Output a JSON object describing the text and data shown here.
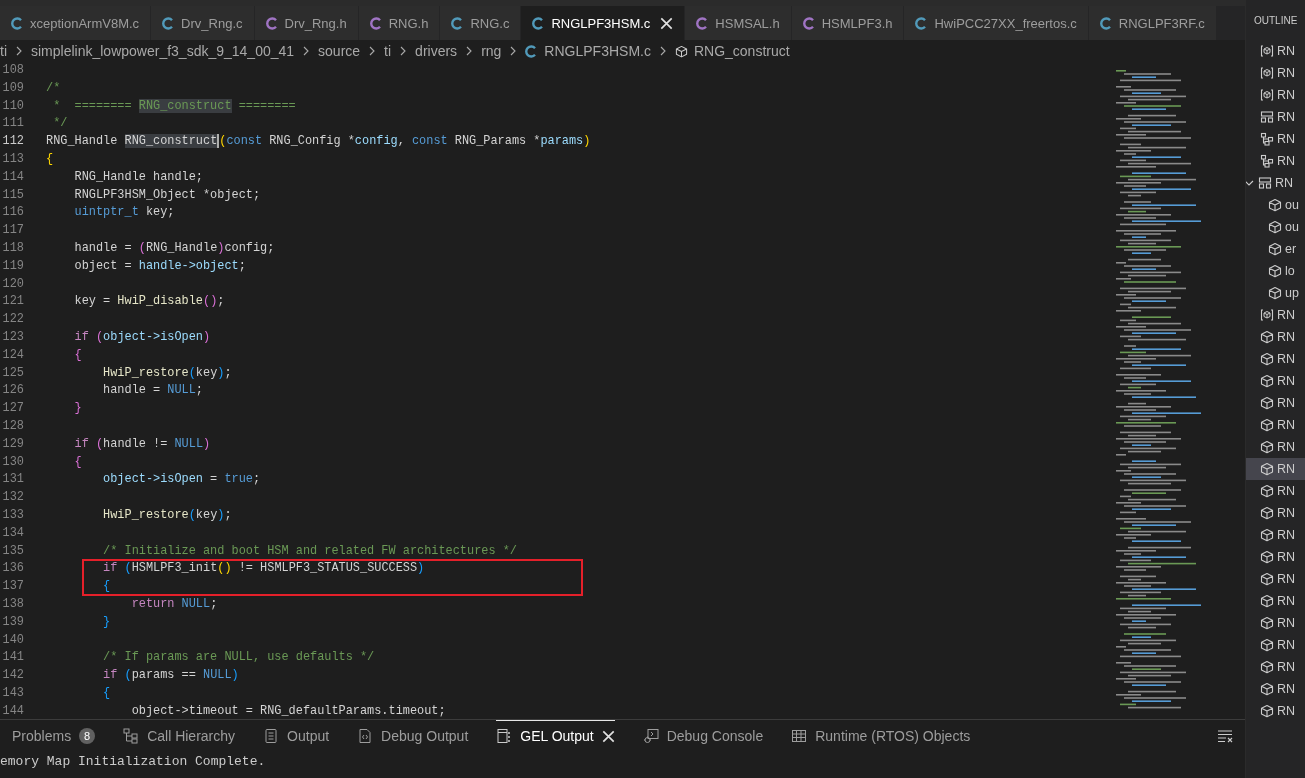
{
  "editor_tabs": [
    {
      "label": "xceptionArmV8M.c",
      "kind": "source",
      "selected": false
    },
    {
      "label": "Drv_Rng.c",
      "kind": "source",
      "selected": false
    },
    {
      "label": "Drv_Rng.h",
      "kind": "header",
      "selected": false
    },
    {
      "label": "RNG.h",
      "kind": "header",
      "selected": false
    },
    {
      "label": "RNG.c",
      "kind": "source",
      "selected": false
    },
    {
      "label": "RNGLPF3HSM.c",
      "kind": "source",
      "selected": true
    },
    {
      "label": "HSMSAL.h",
      "kind": "header",
      "selected": false
    },
    {
      "label": "HSMLPF3.h",
      "kind": "header",
      "selected": false
    },
    {
      "label": "HwiPCC27XX_freertos.c",
      "kind": "source",
      "selected": false
    },
    {
      "label": "RNGLPF3RF.c",
      "kind": "source",
      "selected": false
    }
  ],
  "breadcrumb": [
    {
      "label": "ti",
      "kind": "folder"
    },
    {
      "label": "simplelink_lowpower_f3_sdk_9_14_00_41",
      "kind": "folder"
    },
    {
      "label": "source",
      "kind": "folder"
    },
    {
      "label": "ti",
      "kind": "folder"
    },
    {
      "label": "drivers",
      "kind": "folder"
    },
    {
      "label": "rng",
      "kind": "folder"
    },
    {
      "label": "RNGLPF3HSM.c",
      "kind": "file"
    },
    {
      "label": "RNG_construct",
      "kind": "symbol"
    }
  ],
  "editor": {
    "lines": [
      {
        "number": "108",
        "current": false
      },
      {
        "number": "109",
        "current": false,
        "tokens": [
          {
            "text": "/*",
            "kind": "comment"
          }
        ]
      },
      {
        "number": "110",
        "current": false,
        "tokens": [
          {
            "text": " *  ======== ",
            "kind": "comment"
          },
          {
            "text": "RNG_construct",
            "kind": "comment-match"
          },
          {
            "text": " ========",
            "kind": "comment"
          }
        ]
      },
      {
        "number": "111",
        "current": false,
        "tokens": [
          {
            "text": " */",
            "kind": "comment"
          }
        ]
      },
      {
        "number": "112",
        "current": true,
        "tokens": [
          {
            "text": "RNG_Handle ",
            "kind": "plain"
          },
          {
            "text": "RNG_construct",
            "kind": "match"
          },
          {
            "text": "(",
            "kind": "bracket1"
          },
          {
            "text": "const",
            "kind": "keyword"
          },
          {
            "text": " RNG_Config *",
            "kind": "plain"
          },
          {
            "text": "config",
            "kind": "variable"
          },
          {
            "text": ", ",
            "kind": "plain"
          },
          {
            "text": "const",
            "kind": "keyword"
          },
          {
            "text": " RNG_Params *",
            "kind": "plain"
          },
          {
            "text": "params",
            "kind": "variable"
          },
          {
            "text": ")",
            "kind": "bracket1"
          }
        ]
      },
      {
        "number": "113",
        "current": false,
        "tokens": [
          {
            "text": "{",
            "kind": "bracket1"
          }
        ]
      },
      {
        "number": "114",
        "current": false,
        "tokens": [
          {
            "text": "    RNG_Handle handle;",
            "kind": "plain"
          }
        ]
      },
      {
        "number": "115",
        "current": false,
        "tokens": [
          {
            "text": "    RNGLPF3HSM_Object *object;",
            "kind": "plain"
          }
        ]
      },
      {
        "number": "116",
        "current": false,
        "tokens": [
          {
            "text": "    uintptr_t",
            "kind": "keyword"
          },
          {
            "text": " key;",
            "kind": "plain"
          }
        ]
      },
      {
        "number": "117",
        "current": false
      },
      {
        "number": "118",
        "current": false,
        "tokens": [
          {
            "text": "    handle = ",
            "kind": "plain"
          },
          {
            "text": "(",
            "kind": "bracket2"
          },
          {
            "text": "RNG_Handle",
            "kind": "plain"
          },
          {
            "text": ")",
            "kind": "bracket2"
          },
          {
            "text": "config;",
            "kind": "plain"
          }
        ]
      },
      {
        "number": "119",
        "current": false,
        "tokens": [
          {
            "text": "    object = ",
            "kind": "plain"
          },
          {
            "text": "handle->object",
            "kind": "variable"
          },
          {
            "text": ";",
            "kind": "plain"
          }
        ]
      },
      {
        "number": "120",
        "current": false
      },
      {
        "number": "121",
        "current": false,
        "tokens": [
          {
            "text": "    key = ",
            "kind": "plain"
          },
          {
            "text": "HwiP_disable",
            "kind": "function"
          },
          {
            "text": "()",
            "kind": "bracket2"
          },
          {
            "text": ";",
            "kind": "plain"
          }
        ]
      },
      {
        "number": "122",
        "current": false
      },
      {
        "number": "123",
        "current": false,
        "tokens": [
          {
            "text": "    if",
            "kind": "control"
          },
          {
            "text": " (",
            "kind": "bracket2"
          },
          {
            "text": "object->isOpen",
            "kind": "variable"
          },
          {
            "text": ")",
            "kind": "bracket2"
          }
        ]
      },
      {
        "number": "124",
        "current": false,
        "tokens": [
          {
            "text": "    {",
            "kind": "bracket2"
          }
        ]
      },
      {
        "number": "125",
        "current": false,
        "tokens": [
          {
            "text": "        HwiP_restore",
            "kind": "function"
          },
          {
            "text": "(",
            "kind": "bracket3"
          },
          {
            "text": "key",
            "kind": "plain"
          },
          {
            "text": ")",
            "kind": "bracket3"
          },
          {
            "text": ";",
            "kind": "plain"
          }
        ]
      },
      {
        "number": "126",
        "current": false,
        "tokens": [
          {
            "text": "        handle = ",
            "kind": "plain"
          },
          {
            "text": "NULL",
            "kind": "keyword"
          },
          {
            "text": ";",
            "kind": "plain"
          }
        ]
      },
      {
        "number": "127",
        "current": false,
        "tokens": [
          {
            "text": "    }",
            "kind": "bracket2"
          }
        ]
      },
      {
        "number": "128",
        "current": false
      },
      {
        "number": "129",
        "current": false,
        "tokens": [
          {
            "text": "    if",
            "kind": "control"
          },
          {
            "text": " (",
            "kind": "bracket2"
          },
          {
            "text": "handle != ",
            "kind": "plain"
          },
          {
            "text": "NULL",
            "kind": "keyword"
          },
          {
            "text": ")",
            "kind": "bracket2"
          }
        ]
      },
      {
        "number": "130",
        "current": false,
        "tokens": [
          {
            "text": "    {",
            "kind": "bracket2"
          }
        ]
      },
      {
        "number": "131",
        "current": false,
        "tokens": [
          {
            "text": "        object->isOpen",
            "kind": "variable"
          },
          {
            "text": " = ",
            "kind": "plain"
          },
          {
            "text": "true",
            "kind": "keyword"
          },
          {
            "text": ";",
            "kind": "plain"
          }
        ]
      },
      {
        "number": "132",
        "current": false
      },
      {
        "number": "133",
        "current": false,
        "tokens": [
          {
            "text": "        HwiP_restore",
            "kind": "function"
          },
          {
            "text": "(",
            "kind": "bracket3"
          },
          {
            "text": "key",
            "kind": "plain"
          },
          {
            "text": ")",
            "kind": "bracket3"
          },
          {
            "text": ";",
            "kind": "plain"
          }
        ]
      },
      {
        "number": "134",
        "current": false
      },
      {
        "number": "135",
        "current": false,
        "tokens": [
          {
            "text": "        /* Initialize and boot HSM and related FW architectures */",
            "kind": "comment"
          }
        ]
      },
      {
        "number": "136",
        "current": false,
        "tokens": [
          {
            "text": "        if",
            "kind": "control"
          },
          {
            "text": " (",
            "kind": "bracket3"
          },
          {
            "text": "HSMLPF3_init",
            "kind": "plain"
          },
          {
            "text": "()",
            "kind": "bracket1"
          },
          {
            "text": " != HSMLPF3_STATUS_SUCCESS",
            "kind": "plain"
          },
          {
            "text": ")",
            "kind": "bracket3"
          }
        ]
      },
      {
        "number": "137",
        "current": false,
        "tokens": [
          {
            "text": "        {",
            "kind": "bracket3"
          }
        ]
      },
      {
        "number": "138",
        "current": false,
        "tokens": [
          {
            "text": "            return",
            "kind": "control"
          },
          {
            "text": " NULL",
            "kind": "keyword"
          },
          {
            "text": ";",
            "kind": "plain"
          }
        ]
      },
      {
        "number": "139",
        "current": false,
        "tokens": [
          {
            "text": "        }",
            "kind": "bracket3"
          }
        ]
      },
      {
        "number": "140",
        "current": false
      },
      {
        "number": "141",
        "current": false,
        "tokens": [
          {
            "text": "        /* If params are NULL, use defaults */",
            "kind": "comment"
          }
        ]
      },
      {
        "number": "142",
        "current": false,
        "tokens": [
          {
            "text": "        if",
            "kind": "control"
          },
          {
            "text": " (",
            "kind": "bracket3"
          },
          {
            "text": "params == ",
            "kind": "plain"
          },
          {
            "text": "NULL",
            "kind": "keyword"
          },
          {
            "text": ")",
            "kind": "bracket3"
          }
        ]
      },
      {
        "number": "143",
        "current": false,
        "tokens": [
          {
            "text": "        {",
            "kind": "bracket3"
          }
        ]
      },
      {
        "number": "144",
        "current": false,
        "tokens": [
          {
            "text": "            object->timeout = RNG_defaultParams.timeout;",
            "kind": "plain"
          }
        ]
      }
    ]
  },
  "panel": {
    "tabs": [
      {
        "label": "Problems",
        "badge": "8",
        "selected": false
      },
      {
        "label": "Call Hierarchy",
        "selected": false
      },
      {
        "label": "Output",
        "selected": false
      },
      {
        "label": "Debug Output",
        "selected": false
      },
      {
        "label": "GEL Output",
        "selected": true
      },
      {
        "label": "Debug Console",
        "selected": false
      },
      {
        "label": "Runtime (RTOS) Objects",
        "selected": false
      }
    ],
    "output": "emory Map Initialization Complete."
  },
  "outline": {
    "title": "OUTLINE",
    "items": [
      {
        "kind": "variable",
        "label": "RN",
        "selected": false
      },
      {
        "kind": "variable",
        "label": "RN",
        "selected": false
      },
      {
        "kind": "variable",
        "label": "RN",
        "selected": false
      },
      {
        "kind": "struct",
        "label": "RN",
        "selected": false
      },
      {
        "kind": "type",
        "label": "RN",
        "selected": false
      },
      {
        "kind": "type",
        "label": "RN",
        "selected": false
      },
      {
        "kind": "struct",
        "label": "RN",
        "selected": false,
        "expanded": true,
        "children": [
          {
            "kind": "field",
            "label": "ou",
            "selected": false
          },
          {
            "kind": "field",
            "label": "ou",
            "selected": false
          },
          {
            "kind": "field",
            "label": "er",
            "selected": false
          },
          {
            "kind": "field",
            "label": "lo",
            "selected": false
          },
          {
            "kind": "field",
            "label": "up",
            "selected": false
          }
        ]
      },
      {
        "kind": "variable",
        "label": "RN",
        "selected": false
      },
      {
        "kind": "function",
        "label": "RN",
        "selected": false
      },
      {
        "kind": "function",
        "label": "RN",
        "selected": false
      },
      {
        "kind": "function",
        "label": "RN",
        "selected": false
      },
      {
        "kind": "function",
        "label": "RN",
        "selected": false
      },
      {
        "kind": "function",
        "label": "RN",
        "selected": false
      },
      {
        "kind": "function",
        "label": "RN",
        "selected": false
      },
      {
        "kind": "function",
        "label": "RN",
        "selected": true
      },
      {
        "kind": "function",
        "label": "RN",
        "selected": false
      },
      {
        "kind": "function",
        "label": "RN",
        "selected": false
      },
      {
        "kind": "function",
        "label": "RN",
        "selected": false
      },
      {
        "kind": "function",
        "label": "RN",
        "selected": false
      },
      {
        "kind": "function",
        "label": "RN",
        "selected": false
      },
      {
        "kind": "function",
        "label": "RN",
        "selected": false
      },
      {
        "kind": "function",
        "label": "RN",
        "selected": false
      },
      {
        "kind": "function",
        "label": "RN",
        "selected": false
      },
      {
        "kind": "function",
        "label": "RN",
        "selected": false
      },
      {
        "kind": "function",
        "label": "RN",
        "selected": false
      },
      {
        "kind": "function",
        "label": "RN",
        "selected": false
      }
    ]
  }
}
